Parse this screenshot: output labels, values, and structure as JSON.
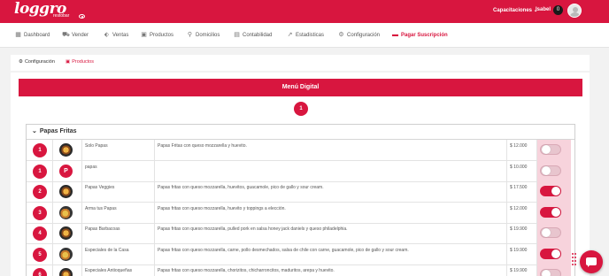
{
  "brand": {
    "logo": "loggro",
    "sub": "restobar",
    "accent": "#d8163f"
  },
  "header": {
    "training_menu": "Capacitaciones ⌄",
    "user_name": "Isabel",
    "notif_count": "0"
  },
  "nav": [
    {
      "label": "Dashboard",
      "icon": "dashboard-icon",
      "glyph": "▦"
    },
    {
      "label": "Vender",
      "icon": "cart-icon",
      "glyph": "⛟"
    },
    {
      "label": "Ventas",
      "icon": "tag-icon",
      "glyph": "⬖"
    },
    {
      "label": "Productos",
      "icon": "box-icon",
      "glyph": "▣"
    },
    {
      "label": "Domicilios",
      "icon": "motorbike-icon",
      "glyph": "⚲"
    },
    {
      "label": "Contabilidad",
      "icon": "calculator-icon",
      "glyph": "▤"
    },
    {
      "label": "Estadisticas",
      "icon": "chart-line-icon",
      "glyph": "↗"
    },
    {
      "label": "Configuración",
      "icon": "gear-icon",
      "glyph": "⚙"
    },
    {
      "label": "Pagar Suscripción",
      "icon": "card-icon",
      "glyph": "▬"
    }
  ],
  "subnav": [
    {
      "label": "Configuración",
      "glyph": "⚙"
    },
    {
      "label": "Productos",
      "glyph": "▣"
    }
  ],
  "menu": {
    "title": "Menú Digital",
    "step": "1",
    "category": "Papas Fritas",
    "products": [
      {
        "pos": "1",
        "thumb": "food",
        "name": "Solo Papas",
        "desc": "Papas Fritas con queso mozzarella y huevito.",
        "price": "$ 12.000",
        "enabled": false
      },
      {
        "pos": "1",
        "thumb": "letter",
        "letter": "P",
        "name": "papas",
        "desc": "",
        "price": "$ 10.000",
        "enabled": false
      },
      {
        "pos": "2",
        "thumb": "food",
        "name": "Papas Veggies",
        "desc": "Papas fritas con queso mozzarella, huevitos, guacamole, pico de gallo y sour cream.",
        "price": "$ 17.500",
        "enabled": true
      },
      {
        "pos": "3",
        "thumb": "food2",
        "name": "Arma tus Papas",
        "desc": "Papas fritas con queso mozzarella, huevito y toppings a elección.",
        "price": "$ 12.000",
        "enabled": true
      },
      {
        "pos": "4",
        "thumb": "food",
        "name": "Papas Barbacoas",
        "desc": "Papas fritas con queso mozzarella, pulled pork en salsa honey jack daniels y queso philadelphia.",
        "price": "$ 19.900",
        "enabled": false
      },
      {
        "pos": "5",
        "thumb": "food2",
        "name": "Especiales de la Casa",
        "desc": "Papas fritas con queso mozzarella, carne, pollo desmechados, salsa de chile con carne, guacamole, pico de gallo y sour cream.",
        "price": "$ 19.900",
        "enabled": true
      },
      {
        "pos": "6",
        "thumb": "food",
        "name": "Especiales Antioqueñas",
        "desc": "Papas fritas con queso mozzarella, chorizitos, chicharroncitos, maduritos, arepa y huevito.",
        "price": "$ 19.900",
        "enabled": false
      }
    ]
  }
}
